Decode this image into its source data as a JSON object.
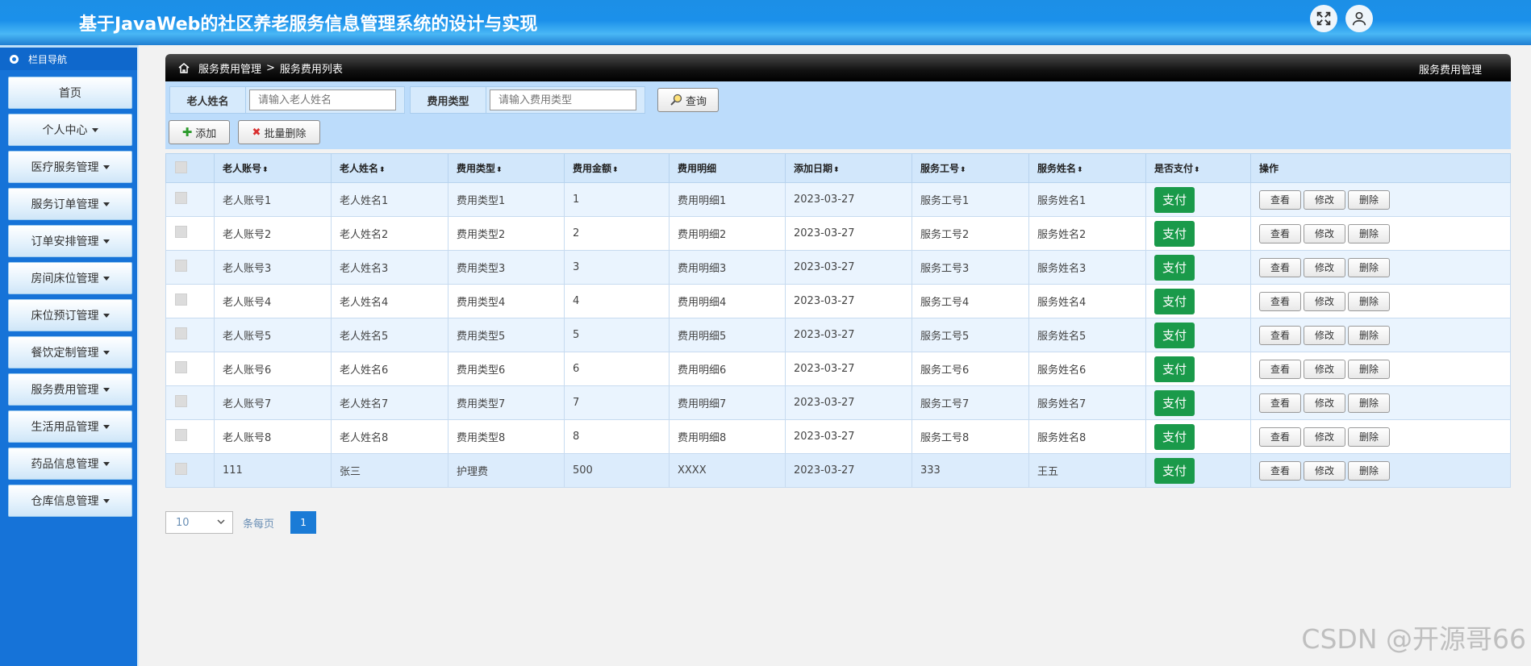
{
  "header": {
    "title": "基于JavaWeb的社区养老服务信息管理系统的设计与实现"
  },
  "sidebar": {
    "heading": "栏目导航",
    "items": [
      {
        "label": "首页",
        "dropdown": false
      },
      {
        "label": "个人中心",
        "dropdown": true
      },
      {
        "label": "医疗服务管理",
        "dropdown": true
      },
      {
        "label": "服务订单管理",
        "dropdown": true
      },
      {
        "label": "订单安排管理",
        "dropdown": true
      },
      {
        "label": "房间床位管理",
        "dropdown": true
      },
      {
        "label": "床位预订管理",
        "dropdown": true
      },
      {
        "label": "餐饮定制管理",
        "dropdown": true
      },
      {
        "label": "服务费用管理",
        "dropdown": true
      },
      {
        "label": "生活用品管理",
        "dropdown": true
      },
      {
        "label": "药品信息管理",
        "dropdown": true
      },
      {
        "label": "仓库信息管理",
        "dropdown": true
      }
    ]
  },
  "breadcrumb": {
    "part1": "服务费用管理",
    "separator": ">",
    "part2": "服务费用列表",
    "right": "服务费用管理"
  },
  "search": {
    "name_label": "老人姓名",
    "name_placeholder": "请输入老人姓名",
    "type_label": "费用类型",
    "type_placeholder": "请输入费用类型",
    "query_label": "查询"
  },
  "toolbar": {
    "add_label": "添加",
    "batch_delete_label": "批量删除"
  },
  "table": {
    "headers": [
      "老人账号",
      "老人姓名",
      "费用类型",
      "费用金额",
      "费用明细",
      "添加日期",
      "服务工号",
      "服务姓名",
      "是否支付",
      "操作"
    ],
    "pay_label": "支付",
    "view_label": "查看",
    "edit_label": "修改",
    "delete_label": "删除",
    "rows": [
      [
        "老人账号1",
        "老人姓名1",
        "费用类型1",
        "1",
        "费用明细1",
        "2023-03-27",
        "服务工号1",
        "服务姓名1"
      ],
      [
        "老人账号2",
        "老人姓名2",
        "费用类型2",
        "2",
        "费用明细2",
        "2023-03-27",
        "服务工号2",
        "服务姓名2"
      ],
      [
        "老人账号3",
        "老人姓名3",
        "费用类型3",
        "3",
        "费用明细3",
        "2023-03-27",
        "服务工号3",
        "服务姓名3"
      ],
      [
        "老人账号4",
        "老人姓名4",
        "费用类型4",
        "4",
        "费用明细4",
        "2023-03-27",
        "服务工号4",
        "服务姓名4"
      ],
      [
        "老人账号5",
        "老人姓名5",
        "费用类型5",
        "5",
        "费用明细5",
        "2023-03-27",
        "服务工号5",
        "服务姓名5"
      ],
      [
        "老人账号6",
        "老人姓名6",
        "费用类型6",
        "6",
        "费用明细6",
        "2023-03-27",
        "服务工号6",
        "服务姓名6"
      ],
      [
        "老人账号7",
        "老人姓名7",
        "费用类型7",
        "7",
        "费用明细7",
        "2023-03-27",
        "服务工号7",
        "服务姓名7"
      ],
      [
        "老人账号8",
        "老人姓名8",
        "费用类型8",
        "8",
        "费用明细8",
        "2023-03-27",
        "服务工号8",
        "服务姓名8"
      ],
      [
        "111",
        "张三",
        "护理费",
        "500",
        "XXXX",
        "2023-03-27",
        "333",
        "王五"
      ]
    ]
  },
  "pager": {
    "page_size": "10",
    "per_page_label": "条每页",
    "current_page": "1"
  },
  "watermark": "CSDN @开源哥66",
  "colors": {
    "header_blue": "#1b90ea",
    "sidebar_blue": "#1673d8",
    "pay_green": "#1a9a4a",
    "page_blue": "#1a7bd6"
  }
}
